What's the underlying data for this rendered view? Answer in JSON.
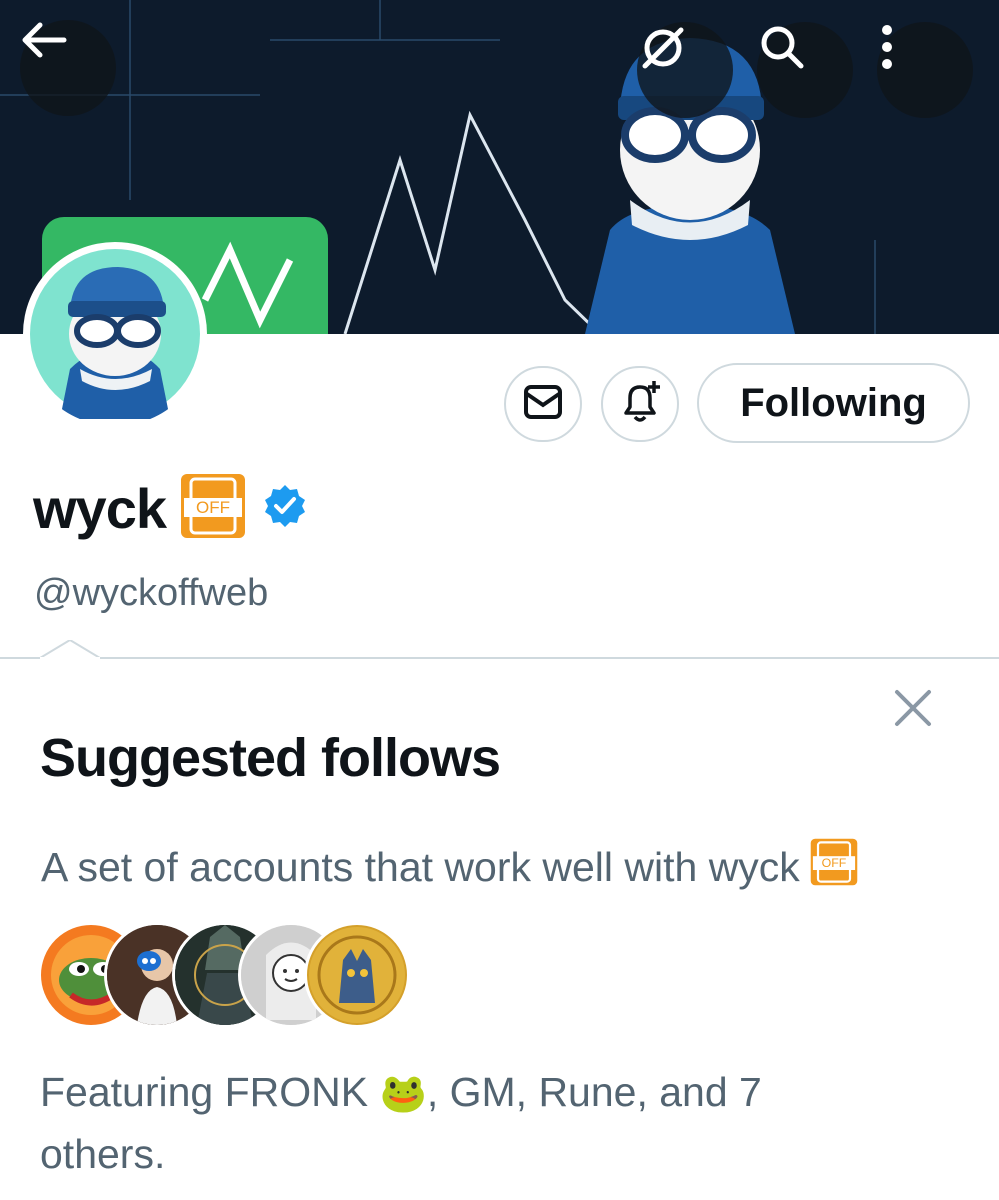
{
  "header": {
    "back_icon": "arrow-left-icon",
    "nostr_icon": "nostr-logo-icon",
    "search_icon": "search-icon",
    "more_icon": "more-vertical-icon"
  },
  "profile": {
    "display_name": "wyck",
    "badge_text": "OFF",
    "verified": true,
    "handle": "@wyckoffweb"
  },
  "actions": {
    "message_icon": "envelope-icon",
    "notify_icon": "bell-plus-icon",
    "following_label": "Following"
  },
  "suggested": {
    "title": "Suggested follows",
    "subtitle": "A set of accounts that work well with wyck",
    "featuring_prefix": "Featuring FRONK",
    "featuring_emoji": "🐸",
    "featuring_suffix": ", GM, Rune, and 7 others.",
    "close_icon": "close-icon"
  },
  "colors": {
    "accent": "#1d9bf0",
    "badge_orange": "#f29a1f",
    "muted_text": "#536471",
    "banner_bg": "#0d1b2c"
  }
}
